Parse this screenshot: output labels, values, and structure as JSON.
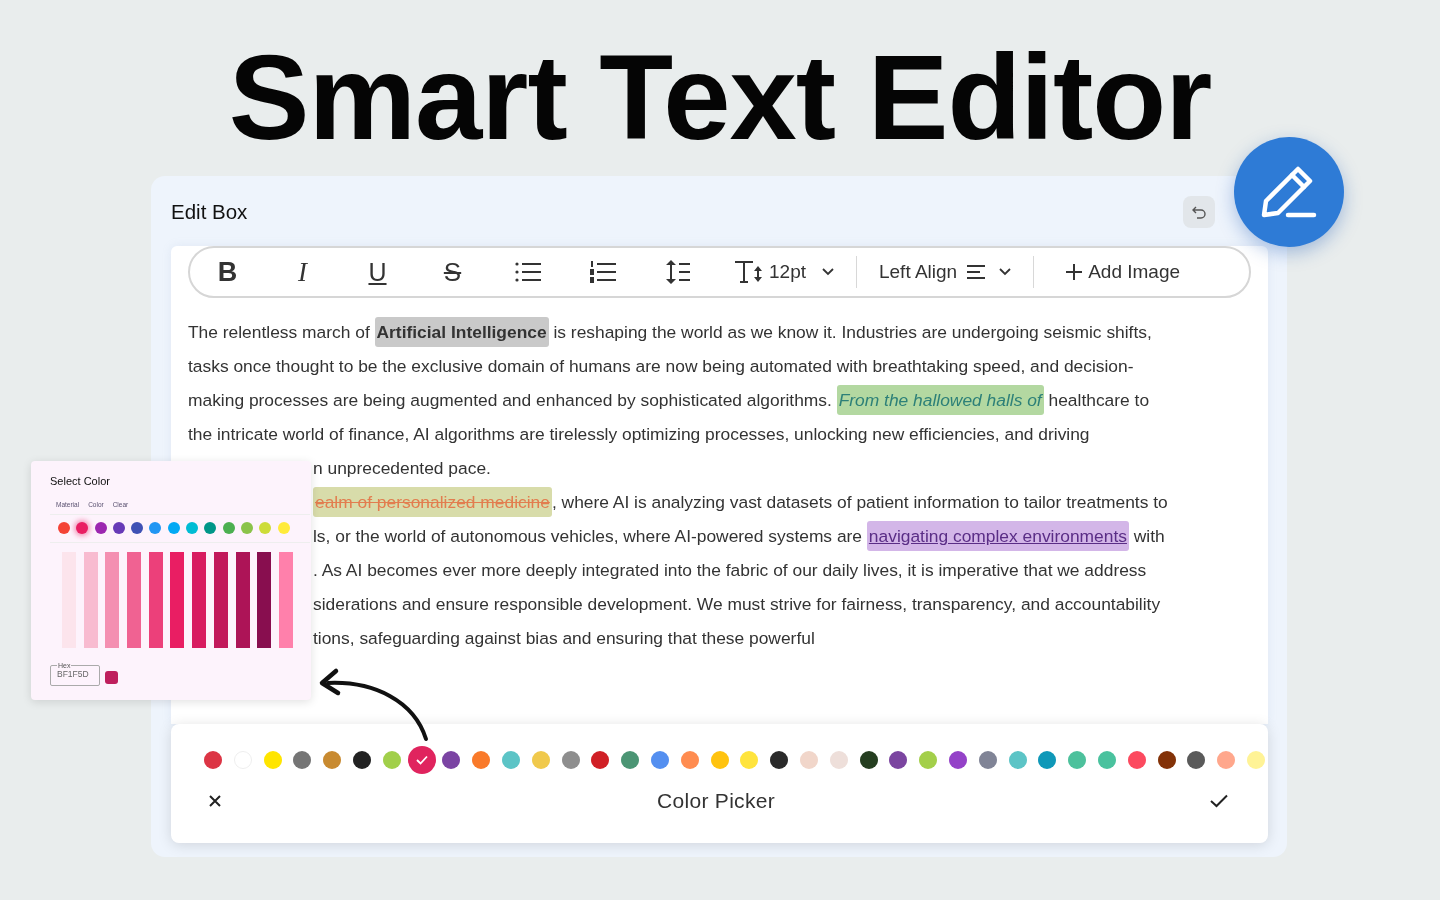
{
  "headline": "Smart Text Editor",
  "editor": {
    "title": "Edit Box",
    "toolbar": [
      {
        "kind": "bold",
        "label": "B"
      },
      {
        "kind": "italic",
        "label": "I"
      },
      {
        "kind": "underline",
        "label": "U"
      },
      {
        "kind": "strike",
        "label": "S"
      },
      {
        "kind": "bullets"
      },
      {
        "kind": "numbers"
      },
      {
        "kind": "spacing"
      },
      {
        "kind": "size",
        "label": "12pt"
      },
      {
        "kind": "align",
        "label": "Left Align"
      },
      {
        "kind": "add",
        "label": "Add Image"
      }
    ],
    "lines": [
      {
        "covered": false,
        "segments": [
          {
            "kind": "plain",
            "text": "The relentless march of "
          },
          {
            "kind": "bold",
            "text": "Artificial Intelligence"
          },
          {
            "kind": "plain",
            "text": " is reshaping the world as we know it. Industries are undergoing seismic shifts,"
          }
        ]
      },
      {
        "covered": false,
        "segments": [
          {
            "kind": "plain",
            "text": "tasks once thought to be the exclusive domain of humans are now being automated with breathtaking speed, and decision-"
          }
        ]
      },
      {
        "covered": false,
        "segments": [
          {
            "kind": "plain",
            "text": "making processes are being augmented and enhanced by sophisticated algorithms. "
          },
          {
            "kind": "italic",
            "text": "From the hallowed halls of"
          },
          {
            "kind": "plain",
            "text": " healthcare to"
          }
        ]
      },
      {
        "covered": false,
        "segments": [
          {
            "kind": "plain",
            "text": "the intricate world of finance, AI algorithms are tirelessly optimizing processes, unlocking new efficiencies, and driving"
          }
        ]
      },
      {
        "covered": true,
        "segments": [
          {
            "kind": "plain",
            "text": "n unprecedented pace."
          }
        ]
      },
      {
        "covered": true,
        "segments": [
          {
            "kind": "strike",
            "text": "ealm of personalized medicine"
          },
          {
            "kind": "plain",
            "text": ", where AI is analyzing vast datasets of patient information to tailor treatments to"
          }
        ]
      },
      {
        "covered": true,
        "segments": [
          {
            "kind": "plain",
            "text": "ls, or the world of autonomous vehicles, where AI-powered systems are "
          },
          {
            "kind": "underline",
            "text": "navigating complex environments"
          },
          {
            "kind": "plain",
            "text": " with"
          }
        ]
      },
      {
        "covered": true,
        "segments": [
          {
            "kind": "plain",
            "text": ". As AI becomes ever more deeply integrated into the fabric of our daily lives, it is imperative that we address"
          }
        ]
      },
      {
        "covered": true,
        "segments": [
          {
            "kind": "plain",
            "text": "siderations and ensure responsible development. We must strive for fairness, transparency, and accountability"
          }
        ]
      },
      {
        "covered": true,
        "segments": [
          {
            "kind": "plain",
            "text": "tions, safeguarding against bias and ensuring that these powerful"
          }
        ]
      }
    ]
  },
  "color_picker": {
    "title": "Color Picker",
    "colors": [
      {
        "color": "#dc3545",
        "selected": false
      },
      {
        "color": "#ffffff",
        "selected": false
      },
      {
        "color": "#ffe500",
        "selected": false
      },
      {
        "color": "#757575",
        "selected": false
      },
      {
        "color": "#c88a30",
        "selected": false
      },
      {
        "color": "#222222",
        "selected": false
      },
      {
        "color": "#a1cf4a",
        "selected": false
      },
      {
        "color": "#e0245e",
        "selected": true
      },
      {
        "color": "#7b44a3",
        "selected": false
      },
      {
        "color": "#f97a2a",
        "selected": false
      },
      {
        "color": "#5cc4c6",
        "selected": false
      },
      {
        "color": "#f0c94c",
        "selected": false
      },
      {
        "color": "#8e8e8e",
        "selected": false
      },
      {
        "color": "#d02026",
        "selected": false
      },
      {
        "color": "#4b9574",
        "selected": false
      },
      {
        "color": "#548ff0",
        "selected": false
      },
      {
        "color": "#ff8c50",
        "selected": false
      },
      {
        "color": "#ffc30f",
        "selected": false
      },
      {
        "color": "#ffe43d",
        "selected": false
      },
      {
        "color": "#2a2a2a",
        "selected": false
      },
      {
        "color": "#f1d6ca",
        "selected": false
      },
      {
        "color": "#eedfda",
        "selected": false
      },
      {
        "color": "#253e20",
        "selected": false
      },
      {
        "color": "#7b45a0",
        "selected": false
      },
      {
        "color": "#a3cf4a",
        "selected": false
      },
      {
        "color": "#9442c8",
        "selected": false
      },
      {
        "color": "#808496",
        "selected": false
      },
      {
        "color": "#5cc4c6",
        "selected": false
      },
      {
        "color": "#0f98b8",
        "selected": false
      },
      {
        "color": "#4dc19c",
        "selected": false
      },
      {
        "color": "#4ac29e",
        "selected": false
      },
      {
        "color": "#fc4a5f",
        "selected": false
      },
      {
        "color": "#833208",
        "selected": false
      },
      {
        "color": "#5a5a5a",
        "selected": false
      },
      {
        "color": "#ffa78c",
        "selected": false
      },
      {
        "color": "#fff396",
        "selected": false
      }
    ]
  },
  "select_color": {
    "title": "Select Color",
    "tabs": [
      "Material",
      "Color",
      "Clear"
    ],
    "colors": [
      {
        "color": "#f44336",
        "selected": false
      },
      {
        "color": "#e91e63",
        "selected": true
      },
      {
        "color": "#9c27b0",
        "selected": false
      },
      {
        "color": "#673ab7",
        "selected": false
      },
      {
        "color": "#3f51b5",
        "selected": false
      },
      {
        "color": "#2196f3",
        "selected": false
      },
      {
        "color": "#03a9f4",
        "selected": false
      },
      {
        "color": "#00bcd4",
        "selected": false
      },
      {
        "color": "#009688",
        "selected": false
      },
      {
        "color": "#4caf50",
        "selected": false
      },
      {
        "color": "#8bc34a",
        "selected": false
      },
      {
        "color": "#cddc39",
        "selected": false
      },
      {
        "color": "#ffeb3b",
        "selected": false
      }
    ],
    "shades": [
      {
        "color": "#fce4ec"
      },
      {
        "color": "#f8bbd0"
      },
      {
        "color": "#f48fb1"
      },
      {
        "color": "#f06292"
      },
      {
        "color": "#ec407a"
      },
      {
        "color": "#e91e63"
      },
      {
        "color": "#d81b60"
      },
      {
        "color": "#c2185b"
      },
      {
        "color": "#ad1457"
      },
      {
        "color": "#880e4f"
      },
      {
        "color": "#ff80ab"
      }
    ],
    "hex_label": "Hex",
    "hex_value": "BF1F5D"
  }
}
